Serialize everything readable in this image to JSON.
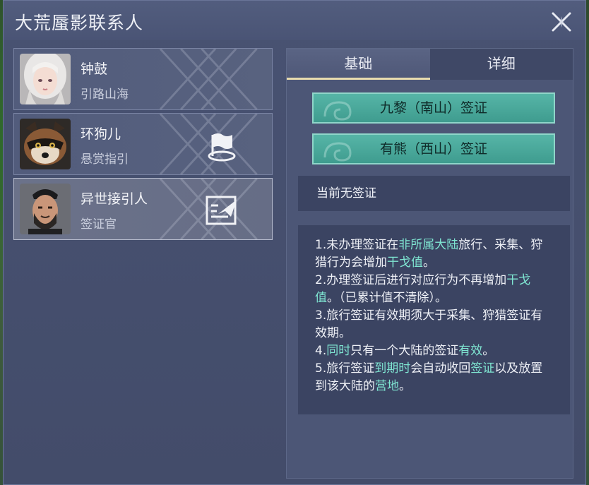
{
  "window": {
    "title": "大荒蜃影联系人"
  },
  "contacts": [
    {
      "name": "钟鼓",
      "role": "引路山海",
      "avatar_icon": "white-haired-woman-avatar",
      "action_icon": ""
    },
    {
      "name": "环狗儿",
      "role": "悬赏指引",
      "avatar_icon": "raccoon-avatar",
      "action_icon": "bounty-flag-icon"
    },
    {
      "name": "异世接引人",
      "role": "签证官",
      "avatar_icon": "bearded-official-avatar",
      "action_icon": "visa-document-icon"
    }
  ],
  "tabs": {
    "basic": "基础",
    "detail": "详细"
  },
  "visa_buttons": {
    "south": "九黎（南山）签证",
    "west": "有熊（西山）签证"
  },
  "status": "当前无签证",
  "info": {
    "l1a": "1.未办理签证在",
    "l1b": "非所属大陆",
    "l1c": "旅行、采集、狩猎行为会增加",
    "l1d": "干戈值",
    "l1e": "。",
    "l2a": "2.办理签证后进行对应行为不再增加",
    "l2b": "干戈值",
    "l2c": "。（已累计值不清除）。",
    "l3": "3.旅行签证有效期须大于采集、狩猎签证有效期。",
    "l4a": "4.",
    "l4b": "同时",
    "l4c": "只有一个大陆的签证",
    "l4d": "有效",
    "l4e": "。",
    "l5a": "5.旅行签证",
    "l5b": "到期时",
    "l5c": "会自动收回",
    "l5d": "签证",
    "l5e": "以及放置到该大陆的",
    "l5f": "营地",
    "l5g": "。"
  },
  "colors": {
    "accent_teal": "#4fae9f",
    "highlight": "#7fe6d2",
    "panel": "#485272"
  }
}
